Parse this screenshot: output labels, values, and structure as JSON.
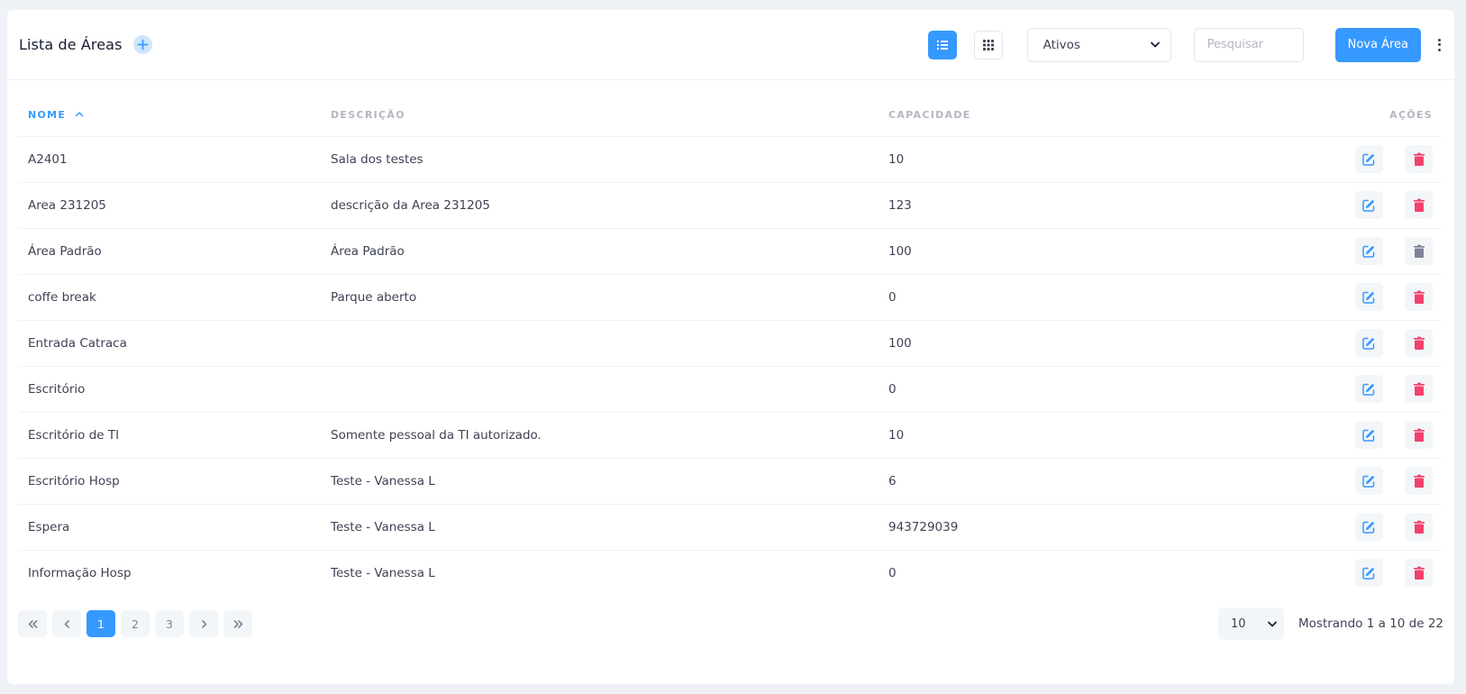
{
  "header": {
    "title": "Lista de Áreas",
    "status_filter": {
      "selected": "Ativos"
    },
    "search_placeholder": "Pesquisar",
    "new_button_label": "Nova Área"
  },
  "table": {
    "columns": {
      "name": "NOME",
      "description": "DESCRIÇÃO",
      "capacity": "CAPACIDADE",
      "actions": "AÇÕES"
    },
    "rows": [
      {
        "name": "A2401",
        "description": "Sala dos testes",
        "capacity": "10",
        "delete_enabled": true
      },
      {
        "name": "Area 231205",
        "description": "descrição da Area 231205",
        "capacity": "123",
        "delete_enabled": true
      },
      {
        "name": "Área Padrão",
        "description": "Área Padrão",
        "capacity": "100",
        "delete_enabled": false
      },
      {
        "name": "coffe break",
        "description": "Parque aberto",
        "capacity": "0",
        "delete_enabled": true
      },
      {
        "name": "Entrada Catraca",
        "description": "",
        "capacity": "100",
        "delete_enabled": true
      },
      {
        "name": "Escritório",
        "description": "",
        "capacity": "0",
        "delete_enabled": true
      },
      {
        "name": "Escritório de TI",
        "description": "Somente pessoal da TI autorizado.",
        "capacity": "10",
        "delete_enabled": true
      },
      {
        "name": "Escritório Hosp",
        "description": "Teste - Vanessa L",
        "capacity": "6",
        "delete_enabled": true
      },
      {
        "name": "Espera",
        "description": "Teste - Vanessa L",
        "capacity": "943729039",
        "delete_enabled": true
      },
      {
        "name": "Informação Hosp",
        "description": "Teste - Vanessa L",
        "capacity": "0",
        "delete_enabled": true
      }
    ]
  },
  "pagination": {
    "pages": [
      "1",
      "2",
      "3"
    ],
    "current": "1",
    "per_page": "10",
    "showing_text": "Mostrando 1 a 10 de 22"
  },
  "colors": {
    "primary": "#3699ff",
    "danger": "#f1416c",
    "disabled": "#7e8299"
  }
}
